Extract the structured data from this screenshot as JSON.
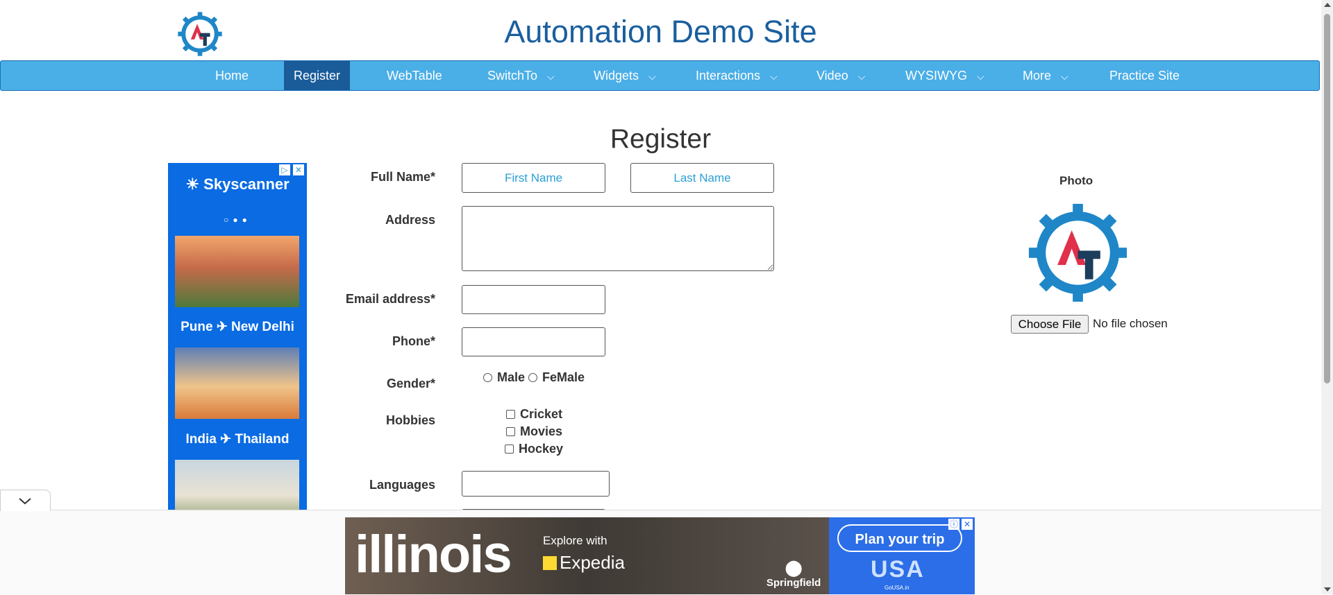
{
  "site": {
    "title": "Automation Demo Site"
  },
  "nav": {
    "items": [
      {
        "label": "Home",
        "dropdown": false
      },
      {
        "label": "Register",
        "dropdown": false,
        "active": true
      },
      {
        "label": "WebTable",
        "dropdown": false
      },
      {
        "label": "SwitchTo",
        "dropdown": true
      },
      {
        "label": "Widgets",
        "dropdown": true
      },
      {
        "label": "Interactions",
        "dropdown": true
      },
      {
        "label": "Video",
        "dropdown": true
      },
      {
        "label": "WYSIWYG",
        "dropdown": true
      },
      {
        "label": "More",
        "dropdown": true
      },
      {
        "label": "Practice Site",
        "dropdown": false
      }
    ]
  },
  "form": {
    "title": "Register",
    "full_name_label": "Full Name*",
    "first_name_placeholder": "First Name",
    "last_name_placeholder": "Last Name",
    "address_label": "Address",
    "email_label": "Email address*",
    "phone_label": "Phone*",
    "gender_label": "Gender*",
    "gender_male": "Male",
    "gender_female": "FeMale",
    "hobbies_label": "Hobbies",
    "hobby_cricket": "Cricket",
    "hobby_movies": "Movies",
    "hobby_hockey": "Hockey",
    "languages_label": "Languages"
  },
  "photo": {
    "label": "Photo",
    "choose_file": "Choose File",
    "no_file": "No file chosen"
  },
  "ad_left": {
    "brand": "Skyscanner",
    "route1": "Pune ✈ New Delhi",
    "route2": "India ✈ Thailand"
  },
  "ad_bottom": {
    "headline": "illinois",
    "explore": "Explore with",
    "partner": "Expedia",
    "place": "Springfield",
    "cta": "Plan your trip",
    "usa": "USA",
    "site": "GoUSA.in"
  },
  "colors": {
    "accent": "#4aaee7",
    "active_nav": "#1a5c9a",
    "title": "#1a5f9e"
  }
}
